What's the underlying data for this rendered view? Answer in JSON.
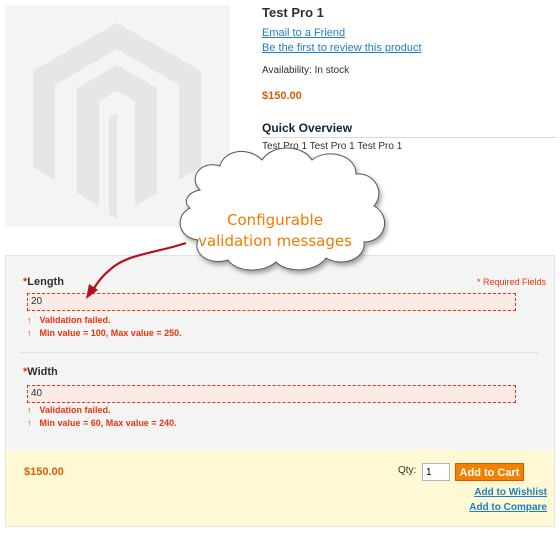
{
  "product": {
    "name": "Test Pro 1",
    "email_link": "Email to a Friend",
    "review_link": "Be the first to review this product",
    "availability_label": "Availability:",
    "availability_value": "In stock",
    "price": "$150.00",
    "quick_overview_heading": "Quick Overview",
    "quick_overview_text": "Test Pro 1 Test Pro 1 Test Pro 1"
  },
  "options": {
    "required_note": "* Required Fields",
    "fields": [
      {
        "star": "*",
        "label": "Length",
        "value": "20",
        "errors": [
          "Validation failed.",
          "Min value = 100, Max value = 250."
        ]
      },
      {
        "star": "*",
        "label": "Width",
        "value": "40",
        "errors": [
          "Validation failed.",
          "Min value = 60, Max value = 240."
        ]
      }
    ],
    "error_arrow": "↑"
  },
  "cart": {
    "price": "$150.00",
    "qty_label": "Qty:",
    "qty_value": "1",
    "add_to_cart": "Add to Cart",
    "wishlist_link": "Add to Wishlist",
    "compare_link": "Add to Compare"
  },
  "callout": {
    "line1": "Configurable",
    "line2": "validation messages"
  },
  "colors": {
    "price": "#dc5b0a",
    "error": "#eb340a",
    "link": "#1e7ec8",
    "button": "#f18200",
    "callout_text": "#f07b00",
    "callout_arrow": "#b5121b"
  }
}
